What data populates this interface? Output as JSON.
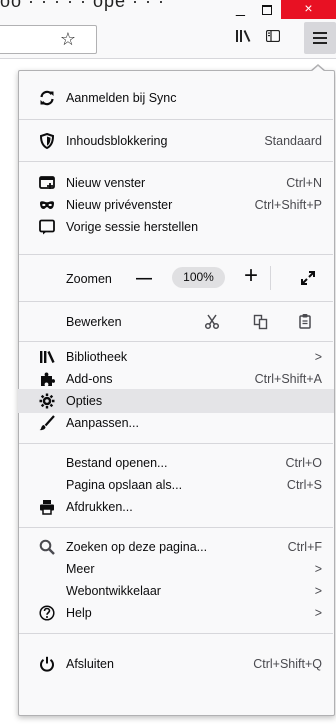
{
  "window": {
    "title_fragment": "oo · · · · · ope · · ·",
    "min": "_",
    "close": "×"
  },
  "toolbar": {
    "bookmark_star": "☆"
  },
  "menu": {
    "sync": "Aanmelden bij Sync",
    "content_blocking": {
      "label": "Inhoudsblokkering",
      "value": "Standaard"
    },
    "new_window": {
      "label": "Nieuw venster",
      "shortcut": "Ctrl+N"
    },
    "private_window": {
      "label": "Nieuw privévenster",
      "shortcut": "Ctrl+Shift+P"
    },
    "restore_session": "Vorige sessie herstellen",
    "zoom": {
      "label": "Zoomen",
      "minus": "—",
      "value": "100%",
      "plus": "+"
    },
    "edit": {
      "label": "Bewerken"
    },
    "library": {
      "label": "Bibliotheek",
      "arrow": ">"
    },
    "addons": {
      "label": "Add-ons",
      "shortcut": "Ctrl+Shift+A"
    },
    "options": "Opties",
    "customize": "Aanpassen...",
    "open_file": {
      "label": "Bestand openen...",
      "shortcut": "Ctrl+O"
    },
    "save_page": {
      "label": "Pagina opslaan als...",
      "shortcut": "Ctrl+S"
    },
    "print": "Afdrukken...",
    "find": {
      "label": "Zoeken op deze pagina...",
      "shortcut": "Ctrl+F"
    },
    "more": {
      "label": "Meer",
      "arrow": ">"
    },
    "web_developer": {
      "label": "Webontwikkelaar",
      "arrow": ">"
    },
    "help": {
      "label": "Help",
      "arrow": ">"
    },
    "quit": {
      "label": "Afsluiten",
      "shortcut": "Ctrl+Shift+Q"
    }
  }
}
